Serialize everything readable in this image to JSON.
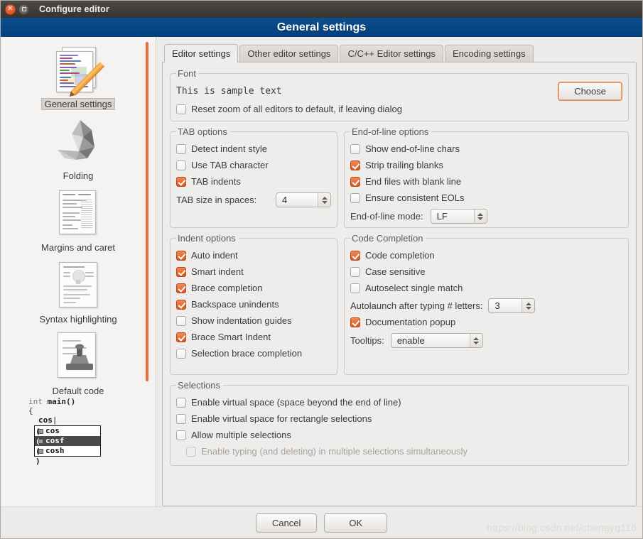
{
  "window": {
    "title": "Configure editor",
    "close_icon": "close-icon",
    "maximize_icon": "maximize-icon"
  },
  "header": {
    "title": "General settings"
  },
  "sidebar": {
    "items": [
      {
        "label": "General settings",
        "icon": "document-pencil-icon",
        "selected": true
      },
      {
        "label": "Folding",
        "icon": "origami-bird-icon",
        "selected": false
      },
      {
        "label": "Margins and caret",
        "icon": "lined-document-icon",
        "selected": false
      },
      {
        "label": "Syntax highlighting",
        "icon": "highlighted-document-icon",
        "selected": false
      },
      {
        "label": "Default code",
        "icon": "stamp-document-icon",
        "selected": false
      }
    ],
    "code_preview": {
      "line1_type": "int",
      "line1_name": "main",
      "line1_parens": "()",
      "line2": "{",
      "line3": "cos",
      "completion_items": [
        "cos",
        "cosf",
        "cosh"
      ],
      "selected_completion": "cosf"
    },
    "scrollbar_color": "#e5703b"
  },
  "tabs": [
    {
      "label": "Editor settings",
      "active": true
    },
    {
      "label": "Other editor settings",
      "active": false
    },
    {
      "label": "C/C++ Editor settings",
      "active": false
    },
    {
      "label": "Encoding settings",
      "active": false
    }
  ],
  "font_group": {
    "legend": "Font",
    "sample_text": "This is sample text",
    "choose_button": "Choose",
    "reset_zoom": {
      "label": "Reset zoom of all editors to default, if leaving dialog",
      "checked": false
    }
  },
  "tab_options": {
    "legend": "TAB options",
    "checkboxes": [
      {
        "label": "Detect indent style",
        "checked": false
      },
      {
        "label": "Use TAB character",
        "checked": false
      },
      {
        "label": "TAB indents",
        "checked": true
      }
    ],
    "tab_size_label": "TAB size in spaces:",
    "tab_size_value": "4"
  },
  "eol_options": {
    "legend": "End-of-line options",
    "checkboxes": [
      {
        "label": "Show end-of-line chars",
        "checked": false
      },
      {
        "label": "Strip trailing blanks",
        "checked": true
      },
      {
        "label": "End files with blank line",
        "checked": true
      },
      {
        "label": "Ensure consistent EOLs",
        "checked": false
      }
    ],
    "eol_mode_label": "End-of-line mode:",
    "eol_mode_value": "LF"
  },
  "indent_options": {
    "legend": "Indent options",
    "checkboxes": [
      {
        "label": "Auto indent",
        "checked": true
      },
      {
        "label": "Smart indent",
        "checked": true
      },
      {
        "label": "Brace completion",
        "checked": true
      },
      {
        "label": "Backspace unindents",
        "checked": true
      },
      {
        "label": "Show indentation guides",
        "checked": false
      },
      {
        "label": "Brace Smart Indent",
        "checked": true
      },
      {
        "label": "Selection brace completion",
        "checked": false
      }
    ]
  },
  "code_completion": {
    "legend": "Code Completion",
    "checkboxes": [
      {
        "label": "Code completion",
        "checked": true
      },
      {
        "label": "Case sensitive",
        "checked": false
      },
      {
        "label": "Autoselect single match",
        "checked": false
      }
    ],
    "autolaunch_label": "Autolaunch after typing # letters:",
    "autolaunch_value": "3",
    "documentation_popup": {
      "label": "Documentation popup",
      "checked": true
    },
    "tooltips_label": "Tooltips:",
    "tooltips_value": "enable"
  },
  "selections": {
    "legend": "Selections",
    "checkboxes": [
      {
        "label": "Enable virtual space (space beyond the end of line)",
        "checked": false,
        "disabled": false
      },
      {
        "label": "Enable virtual space for rectangle selections",
        "checked": false,
        "disabled": false
      },
      {
        "label": "Allow multiple selections",
        "checked": false,
        "disabled": false
      },
      {
        "label": "Enable typing (and deleting) in multiple selections simultaneously",
        "checked": false,
        "disabled": true
      }
    ]
  },
  "footer": {
    "cancel": "Cancel",
    "ok": "OK",
    "watermark": "https://blog.csdn.net/chengyq116"
  },
  "colors": {
    "header_blue": "#064a8c",
    "accent_orange": "#e5703b",
    "checked_box": "#d9561f"
  }
}
